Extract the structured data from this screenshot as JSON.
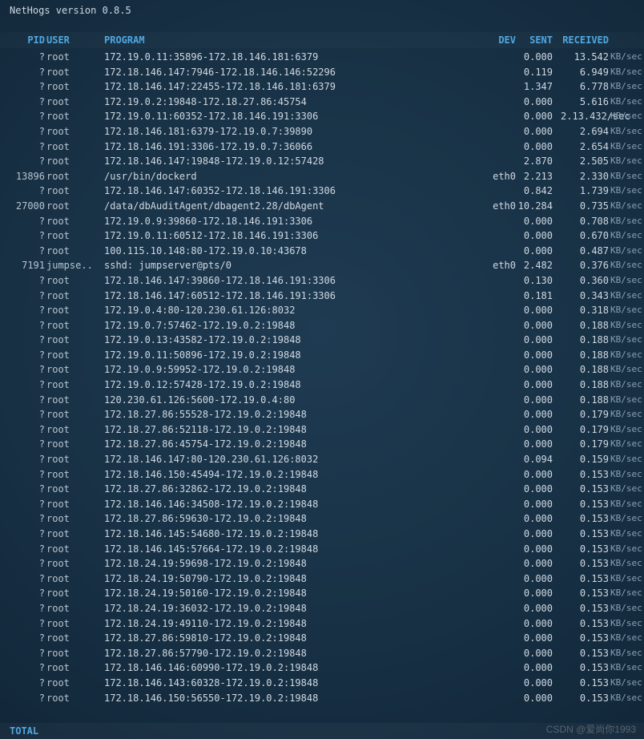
{
  "title": "NetHogs version 0.8.5",
  "headers": {
    "pid": "PID",
    "user": "USER",
    "prog": "PROGRAM",
    "dev": "DEV",
    "sent": "SENT",
    "recv": "RECEIVED"
  },
  "unit": "KB/sec",
  "total_label": "TOTAL",
  "watermark": "CSDN @爱尚你1993",
  "rows": [
    {
      "pid": "?",
      "user": "root",
      "prog": "172.19.0.11:35896-172.18.146.181:6379",
      "dev": "",
      "sent": "0.000",
      "recv": "13.542"
    },
    {
      "pid": "?",
      "user": "root",
      "prog": "172.18.146.147:7946-172.18.146.146:52296",
      "dev": "",
      "sent": "0.119",
      "recv": "6.949"
    },
    {
      "pid": "?",
      "user": "root",
      "prog": "172.18.146.147:22455-172.18.146.181:6379",
      "dev": "",
      "sent": "1.347",
      "recv": "6.778"
    },
    {
      "pid": "?",
      "user": "root",
      "prog": "172.19.0.2:19848-172.18.27.86:45754",
      "dev": "",
      "sent": "0.000",
      "recv": "5.616"
    },
    {
      "pid": "?",
      "user": "root",
      "prog": "172.19.0.11:60352-172.18.146.191:3306",
      "dev": "",
      "sent": "0.000",
      "recv": "2.13.432/sec"
    },
    {
      "pid": "?",
      "user": "root",
      "prog": "172.18.146.181:6379-172.19.0.7:39890",
      "dev": "",
      "sent": "0.000",
      "recv": "2.694"
    },
    {
      "pid": "?",
      "user": "root",
      "prog": "172.18.146.191:3306-172.19.0.7:36066",
      "dev": "",
      "sent": "0.000",
      "recv": "2.654"
    },
    {
      "pid": "?",
      "user": "root",
      "prog": "172.18.146.147:19848-172.19.0.12:57428",
      "dev": "",
      "sent": "2.870",
      "recv": "2.505"
    },
    {
      "pid": "13896",
      "user": "root",
      "prog": "/usr/bin/dockerd",
      "dev": "eth0",
      "sent": "2.213",
      "recv": "2.330"
    },
    {
      "pid": "?",
      "user": "root",
      "prog": "172.18.146.147:60352-172.18.146.191:3306",
      "dev": "",
      "sent": "0.842",
      "recv": "1.739"
    },
    {
      "pid": "27000",
      "user": "root",
      "prog": "/data/dbAuditAgent/dbagent2.28/dbAgent",
      "dev": "eth0",
      "sent": "10.284",
      "recv": "0.735"
    },
    {
      "pid": "?",
      "user": "root",
      "prog": "172.19.0.9:39860-172.18.146.191:3306",
      "dev": "",
      "sent": "0.000",
      "recv": "0.708"
    },
    {
      "pid": "?",
      "user": "root",
      "prog": "172.19.0.11:60512-172.18.146.191:3306",
      "dev": "",
      "sent": "0.000",
      "recv": "0.670"
    },
    {
      "pid": "?",
      "user": "root",
      "prog": "100.115.10.148:80-172.19.0.10:43678",
      "dev": "",
      "sent": "0.000",
      "recv": "0.487"
    },
    {
      "pid": "7191",
      "user": "jumpse..",
      "prog": "sshd: jumpserver@pts/0",
      "dev": "eth0",
      "sent": "2.482",
      "recv": "0.376"
    },
    {
      "pid": "?",
      "user": "root",
      "prog": "172.18.146.147:39860-172.18.146.191:3306",
      "dev": "",
      "sent": "0.130",
      "recv": "0.360"
    },
    {
      "pid": "?",
      "user": "root",
      "prog": "172.18.146.147:60512-172.18.146.191:3306",
      "dev": "",
      "sent": "0.181",
      "recv": "0.343"
    },
    {
      "pid": "?",
      "user": "root",
      "prog": "172.19.0.4:80-120.230.61.126:8032",
      "dev": "",
      "sent": "0.000",
      "recv": "0.318"
    },
    {
      "pid": "?",
      "user": "root",
      "prog": "172.19.0.7:57462-172.19.0.2:19848",
      "dev": "",
      "sent": "0.000",
      "recv": "0.188"
    },
    {
      "pid": "?",
      "user": "root",
      "prog": "172.19.0.13:43582-172.19.0.2:19848",
      "dev": "",
      "sent": "0.000",
      "recv": "0.188"
    },
    {
      "pid": "?",
      "user": "root",
      "prog": "172.19.0.11:50896-172.19.0.2:19848",
      "dev": "",
      "sent": "0.000",
      "recv": "0.188"
    },
    {
      "pid": "?",
      "user": "root",
      "prog": "172.19.0.9:59952-172.19.0.2:19848",
      "dev": "",
      "sent": "0.000",
      "recv": "0.188"
    },
    {
      "pid": "?",
      "user": "root",
      "prog": "172.19.0.12:57428-172.19.0.2:19848",
      "dev": "",
      "sent": "0.000",
      "recv": "0.188"
    },
    {
      "pid": "?",
      "user": "root",
      "prog": "120.230.61.126:5600-172.19.0.4:80",
      "dev": "",
      "sent": "0.000",
      "recv": "0.188"
    },
    {
      "pid": "?",
      "user": "root",
      "prog": "172.18.27.86:55528-172.19.0.2:19848",
      "dev": "",
      "sent": "0.000",
      "recv": "0.179"
    },
    {
      "pid": "?",
      "user": "root",
      "prog": "172.18.27.86:52118-172.19.0.2:19848",
      "dev": "",
      "sent": "0.000",
      "recv": "0.179"
    },
    {
      "pid": "?",
      "user": "root",
      "prog": "172.18.27.86:45754-172.19.0.2:19848",
      "dev": "",
      "sent": "0.000",
      "recv": "0.179"
    },
    {
      "pid": "?",
      "user": "root",
      "prog": "172.18.146.147:80-120.230.61.126:8032",
      "dev": "",
      "sent": "0.094",
      "recv": "0.159"
    },
    {
      "pid": "?",
      "user": "root",
      "prog": "172.18.146.150:45494-172.19.0.2:19848",
      "dev": "",
      "sent": "0.000",
      "recv": "0.153"
    },
    {
      "pid": "?",
      "user": "root",
      "prog": "172.18.27.86:32862-172.19.0.2:19848",
      "dev": "",
      "sent": "0.000",
      "recv": "0.153"
    },
    {
      "pid": "?",
      "user": "root",
      "prog": "172.18.146.146:34508-172.19.0.2:19848",
      "dev": "",
      "sent": "0.000",
      "recv": "0.153"
    },
    {
      "pid": "?",
      "user": "root",
      "prog": "172.18.27.86:59630-172.19.0.2:19848",
      "dev": "",
      "sent": "0.000",
      "recv": "0.153"
    },
    {
      "pid": "?",
      "user": "root",
      "prog": "172.18.146.145:54680-172.19.0.2:19848",
      "dev": "",
      "sent": "0.000",
      "recv": "0.153"
    },
    {
      "pid": "?",
      "user": "root",
      "prog": "172.18.146.145:57664-172.19.0.2:19848",
      "dev": "",
      "sent": "0.000",
      "recv": "0.153"
    },
    {
      "pid": "?",
      "user": "root",
      "prog": "172.18.24.19:59698-172.19.0.2:19848",
      "dev": "",
      "sent": "0.000",
      "recv": "0.153"
    },
    {
      "pid": "?",
      "user": "root",
      "prog": "172.18.24.19:50790-172.19.0.2:19848",
      "dev": "",
      "sent": "0.000",
      "recv": "0.153"
    },
    {
      "pid": "?",
      "user": "root",
      "prog": "172.18.24.19:50160-172.19.0.2:19848",
      "dev": "",
      "sent": "0.000",
      "recv": "0.153"
    },
    {
      "pid": "?",
      "user": "root",
      "prog": "172.18.24.19:36032-172.19.0.2:19848",
      "dev": "",
      "sent": "0.000",
      "recv": "0.153"
    },
    {
      "pid": "?",
      "user": "root",
      "prog": "172.18.24.19:49110-172.19.0.2:19848",
      "dev": "",
      "sent": "0.000",
      "recv": "0.153"
    },
    {
      "pid": "?",
      "user": "root",
      "prog": "172.18.27.86:59810-172.19.0.2:19848",
      "dev": "",
      "sent": "0.000",
      "recv": "0.153"
    },
    {
      "pid": "?",
      "user": "root",
      "prog": "172.18.27.86:57790-172.19.0.2:19848",
      "dev": "",
      "sent": "0.000",
      "recv": "0.153"
    },
    {
      "pid": "?",
      "user": "root",
      "prog": "172.18.146.146:60990-172.19.0.2:19848",
      "dev": "",
      "sent": "0.000",
      "recv": "0.153"
    },
    {
      "pid": "?",
      "user": "root",
      "prog": "172.18.146.143:60328-172.19.0.2:19848",
      "dev": "",
      "sent": "0.000",
      "recv": "0.153"
    },
    {
      "pid": "?",
      "user": "root",
      "prog": "172.18.146.150:56550-172.19.0.2:19848",
      "dev": "",
      "sent": "0.000",
      "recv": "0.153"
    }
  ]
}
